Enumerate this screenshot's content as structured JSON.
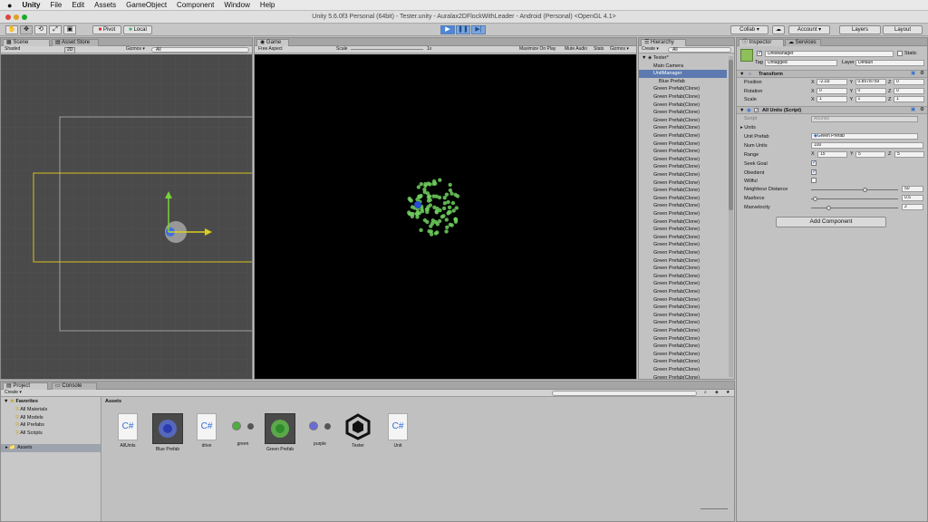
{
  "menubar": {
    "apple": "",
    "items": [
      "Unity",
      "File",
      "Edit",
      "Assets",
      "GameObject",
      "Component",
      "Window",
      "Help"
    ]
  },
  "window_title": "Unity 5.6.0f3 Personal (64bit) - Tester.unity - Auralax2DFlockWithLeader - Android (Personal) <OpenGL 4.1>",
  "toolbar": {
    "tools": [
      "✋",
      "✥",
      "⟲",
      "⤢",
      "▣"
    ],
    "pivot": "Pivot",
    "local": "Local",
    "play": "▶",
    "pause": "❚❚",
    "step": "▶|",
    "collab": "Collab ▾",
    "cloud": "☁",
    "account": "Account ▾",
    "layers": "Layers",
    "layout": "Layout"
  },
  "scene": {
    "tab": "Scene",
    "tab2": "Asset Store",
    "shaded": "Shaded",
    "mode2d": "2D",
    "gizmos": "Gizmos ▾",
    "search": "All"
  },
  "game": {
    "tab": "Game",
    "aspect": "Free Aspect",
    "scale_label": "Scale",
    "scale_value": "1x",
    "maximize": "Maximize On Play",
    "mute": "Mute Audio",
    "stats": "Stats",
    "gizmos": "Gizmos ▾"
  },
  "hierarchy": {
    "tab": "Hierarchy",
    "create": "Create ▾",
    "search": "All",
    "scene": "Tester*",
    "items": [
      "Main Camera",
      "UnitManager",
      "Blue Prefab",
      "Green Prefab(Clone)",
      "Green Prefab(Clone)",
      "Green Prefab(Clone)",
      "Green Prefab(Clone)",
      "Green Prefab(Clone)",
      "Green Prefab(Clone)",
      "Green Prefab(Clone)",
      "Green Prefab(Clone)",
      "Green Prefab(Clone)",
      "Green Prefab(Clone)",
      "Green Prefab(Clone)",
      "Green Prefab(Clone)",
      "Green Prefab(Clone)",
      "Green Prefab(Clone)",
      "Green Prefab(Clone)",
      "Green Prefab(Clone)",
      "Green Prefab(Clone)",
      "Green Prefab(Clone)",
      "Green Prefab(Clone)",
      "Green Prefab(Clone)",
      "Green Prefab(Clone)",
      "Green Prefab(Clone)",
      "Green Prefab(Clone)",
      "Green Prefab(Clone)",
      "Green Prefab(Clone)",
      "Green Prefab(Clone)",
      "Green Prefab(Clone)",
      "Green Prefab(Clone)",
      "Green Prefab(Clone)",
      "Green Prefab(Clone)",
      "Green Prefab(Clone)",
      "Green Prefab(Clone)",
      "Green Prefab(Clone)",
      "Green Prefab(Clone)",
      "Green Prefab(Clone)",
      "Green Prefab(Clone)",
      "Green Prefab(Clone)",
      "Green Prefab(Clone)",
      "Green Prefab(Clone)"
    ]
  },
  "inspector": {
    "tab": "Inspector",
    "tab2": "Services",
    "object_name": "UnitManager",
    "static": "Static",
    "tag_label": "Tag",
    "tag": "Untagged",
    "layer_label": "Layer",
    "layer": "Default",
    "transform": {
      "title": "Transform",
      "position": "Position",
      "rotation": "Rotation",
      "scale": "Scale",
      "x": "X",
      "y": "Y",
      "z": "Z",
      "pos": [
        "-2.03",
        "0.8578759",
        "0"
      ],
      "rot": [
        "0",
        "0",
        "0"
      ],
      "scl": [
        "1",
        "1",
        "1"
      ]
    },
    "script": {
      "title": "All Units (Script)",
      "script_label": "Script",
      "script_value": "AllUnits",
      "units": "Units",
      "unit_prefab_label": "Unit Prefab",
      "unit_prefab": "Green Prefab",
      "num_units_label": "Num Units",
      "num_units": "100",
      "range_label": "Range",
      "range": [
        "15",
        "5",
        "5"
      ],
      "seek_goal": "Seek Goal",
      "obedient": "Obedient",
      "willful": "Willful",
      "neighbour_label": "Neighbour Distance",
      "neighbour": "50",
      "neighbour_frac": 0.62,
      "maxforce_label": "Maxforce",
      "maxforce": "0.5",
      "maxforce_frac": 0.05,
      "maxvel_label": "Maxvelocity",
      "maxvel": "2",
      "maxvel_frac": 0.2
    },
    "add_component": "Add Component"
  },
  "project": {
    "tab": "Project",
    "tab2": "Console",
    "create": "Create ▾",
    "favorites": "Favorites",
    "fav_items": [
      "All Materials",
      "All Models",
      "All Prefabs",
      "All Scripts"
    ],
    "assets_root": "Assets",
    "breadcrumb": "Assets",
    "assets": [
      {
        "name": "AllUnits",
        "icon": "csharp-icon"
      },
      {
        "name": "Blue Prefab",
        "icon": "prefab-icon"
      },
      {
        "name": "drive",
        "icon": "csharp-icon"
      },
      {
        "name": "green",
        "icon": "material-icon"
      },
      {
        "name": "Green Prefab",
        "icon": "prefab-icon"
      },
      {
        "name": "purple",
        "icon": "material-icon"
      },
      {
        "name": "Tester",
        "icon": "unity-scene-icon"
      },
      {
        "name": "Unit",
        "icon": "csharp-icon"
      }
    ]
  },
  "colors": {
    "accent": "#2f6ed6",
    "boid": "#6fcf5e",
    "selection": "#3d7fe6"
  }
}
